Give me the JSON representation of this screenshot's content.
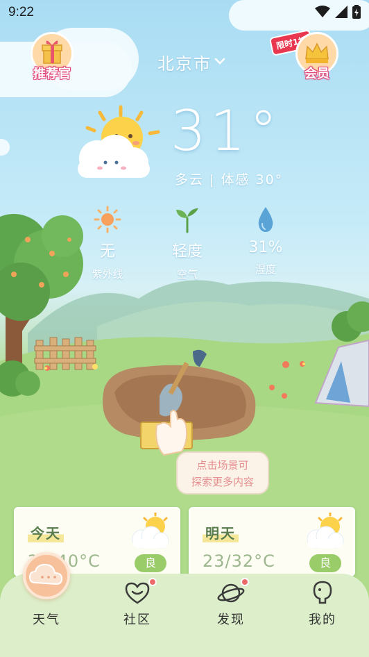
{
  "status_bar": {
    "time": "9:22"
  },
  "header": {
    "left_button_label": "推荐官",
    "city": "北京市",
    "promo_tag": "限时1折",
    "right_button_label": "会员"
  },
  "weather": {
    "temperature": "31°",
    "condition": "多云 | 体感 30°",
    "metrics": [
      {
        "value": "无",
        "label": "紫外线",
        "icon": "sun-icon"
      },
      {
        "value": "轻度",
        "label": "空气",
        "icon": "sprout-icon"
      },
      {
        "value": "31%",
        "label": "湿度",
        "icon": "water-drop-icon"
      }
    ]
  },
  "scene": {
    "hint": "点击场景可",
    "hint2": "探索更多内容"
  },
  "forecast": [
    {
      "day": "今天",
      "range": "23/40°C",
      "aqi": "良"
    },
    {
      "day": "明天",
      "range": "23/32°C",
      "aqi": "良"
    }
  ],
  "tabbar": {
    "tabs": [
      {
        "label": "天气",
        "icon": "cloud-icon",
        "active": true
      },
      {
        "label": "社区",
        "icon": "heart-chat-icon",
        "badge": true
      },
      {
        "label": "发现",
        "icon": "planet-icon",
        "badge": true
      },
      {
        "label": "我的",
        "icon": "profile-icon"
      }
    ]
  },
  "colors": {
    "sky": "#a9dcf3",
    "grass": "#a6d883",
    "tabbar": "#dcefca",
    "accent": "#f7c19b",
    "badge": "#ef6b6b",
    "aqi_good": "#9acc6a"
  }
}
